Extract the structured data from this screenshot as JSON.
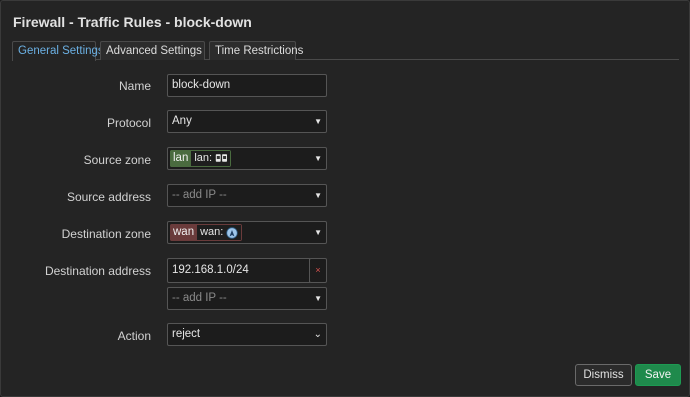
{
  "dialog": {
    "title": "Firewall - Traffic Rules - block-down"
  },
  "tabs": [
    {
      "label": "General Settings",
      "active": true
    },
    {
      "label": "Advanced Settings",
      "active": false
    },
    {
      "label": "Time Restrictions",
      "active": false
    }
  ],
  "form": {
    "name": {
      "label": "Name",
      "value": "block-down"
    },
    "protocol": {
      "label": "Protocol",
      "value": "Any"
    },
    "source_zone": {
      "label": "Source zone",
      "zone": "lan",
      "interfaces": "lan:",
      "color": "#4a6b3f",
      "icon": "ethernet-icon"
    },
    "source_address": {
      "label": "Source address",
      "placeholder": "-- add IP --"
    },
    "destination_zone": {
      "label": "Destination zone",
      "zone": "wan",
      "interfaces": "wan:",
      "color": "#6a3b3b",
      "icon": "wireless-icon"
    },
    "destination_address": {
      "label": "Destination address",
      "value": "192.168.1.0/24",
      "remove_symbol": "×",
      "placeholder": "-- add IP --"
    },
    "action": {
      "label": "Action",
      "value": "reject"
    }
  },
  "footer": {
    "dismiss_label": "Dismiss",
    "save_label": "Save"
  },
  "colors": {
    "accent": "#6bb0e3",
    "save": "#1f8a4c",
    "remove": "#d9534f"
  }
}
